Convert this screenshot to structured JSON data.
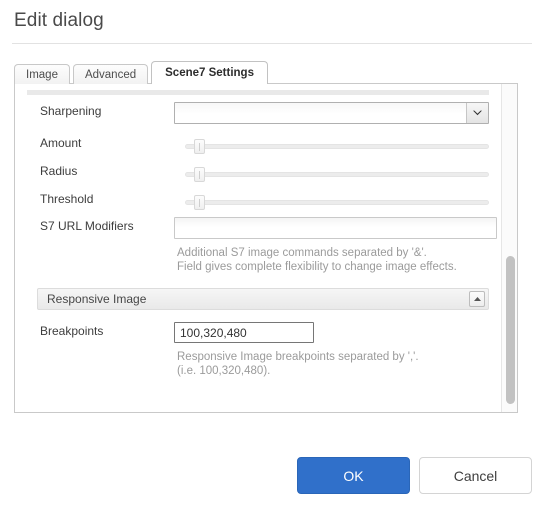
{
  "dialog": {
    "title": "Edit dialog"
  },
  "tabs": [
    {
      "label": "Image",
      "active": false
    },
    {
      "label": "Advanced",
      "active": false
    },
    {
      "label": "Scene7 Settings",
      "active": true
    }
  ],
  "form": {
    "sharpening": {
      "label": "Sharpening",
      "value": "",
      "icon": "chevron-down-icon"
    },
    "amount": {
      "label": "Amount",
      "value": 0
    },
    "radius": {
      "label": "Radius",
      "value": 0
    },
    "threshold": {
      "label": "Threshold",
      "value": 0
    },
    "s7_url_modifiers": {
      "label": "S7 URL Modifiers",
      "value": "",
      "placeholder": "",
      "hint": "Additional S7 image commands separated by '&'.\nField gives complete flexibility to change image effects."
    }
  },
  "responsive_section": {
    "title": "Responsive Image",
    "toggle_icon": "chevron-up-icon",
    "breakpoints": {
      "label": "Breakpoints",
      "value": "100,320,480",
      "hint": "Responsive Image breakpoints separated by ','.\n(i.e. 100,320,480)."
    }
  },
  "footer": {
    "ok_label": "OK",
    "cancel_label": "Cancel"
  },
  "colors": {
    "accent": "#3070ca",
    "panel_border": "#c9c9c9",
    "hint_text": "#9b9b9b"
  }
}
